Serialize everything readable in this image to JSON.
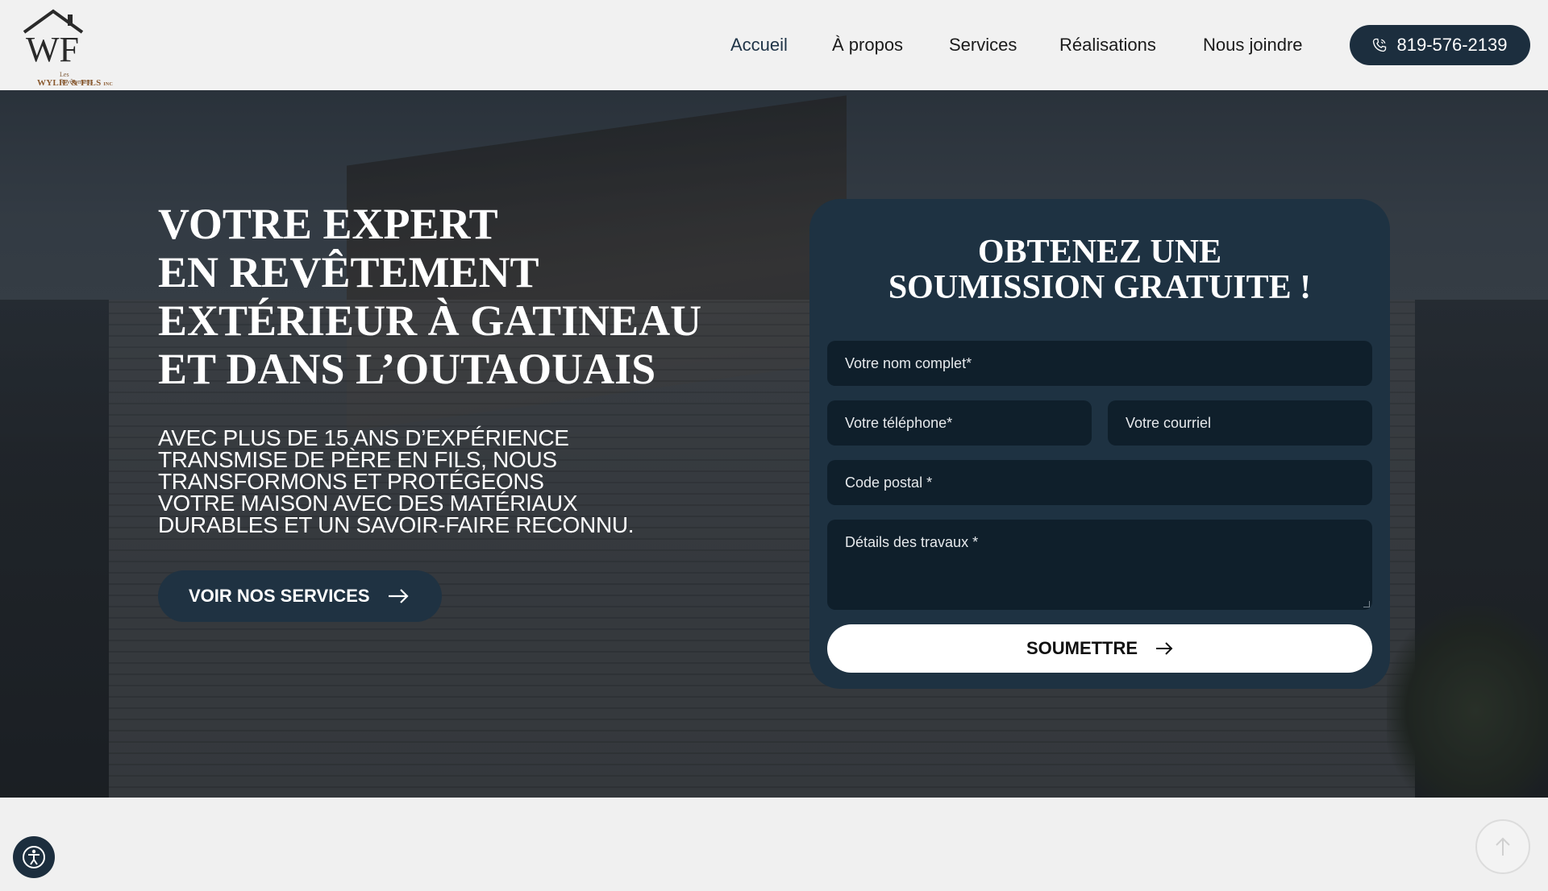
{
  "logo": {
    "monogram": "WF",
    "line1": "Les Revêtements",
    "line2": "WYLIE & FILS",
    "suffix": "INC"
  },
  "nav": {
    "items": [
      {
        "label": "Accueil",
        "active": true
      },
      {
        "label": "À propos",
        "active": false
      },
      {
        "label": "Services",
        "active": false
      },
      {
        "label": "Réalisations",
        "active": false
      },
      {
        "label": "Nous joindre",
        "active": false
      }
    ],
    "phone": "819-576-2139",
    "phone_icon": "phone-icon"
  },
  "hero": {
    "title_lines": [
      "VOTRE EXPERT",
      "EN REVÊTEMENT",
      "EXTÉRIEUR À GATINEAU",
      "ET DANS L’OUTAOUAIS"
    ],
    "subtitle_lines": [
      "AVEC PLUS DE 15 ANS D’EXPÉRIENCE",
      "TRANSMISE DE PÈRE EN FILS, NOUS",
      "TRANSFORMONS ET PROTÉGEONS",
      "VOTRE MAISON AVEC DES MATÉRIAUX",
      "DURABLES ET UN SAVOIR-FAIRE RECONNU."
    ],
    "cta_label": "VOIR NOS SERVICES",
    "cta_icon": "arrow-right-icon"
  },
  "form": {
    "title_lines": [
      "OBTENEZ UNE",
      "SOUMISSION GRATUITE !"
    ],
    "name_placeholder": "Votre nom complet*",
    "phone_placeholder": "Votre téléphone*",
    "email_placeholder": "Votre courriel",
    "postal_placeholder": "Code postal *",
    "details_placeholder": "Détails des travaux *",
    "submit_label": "SOUMETTRE",
    "submit_icon": "arrow-right-icon"
  },
  "widgets": {
    "accessibility_icon": "accessibility-icon",
    "scroll_top_icon": "arrow-up-icon"
  },
  "colors": {
    "brand_dark": "#1c2e3e",
    "form_bg": "#1e3242",
    "field_bg": "#0f1f2b",
    "logo_brown": "#8a5a30"
  }
}
